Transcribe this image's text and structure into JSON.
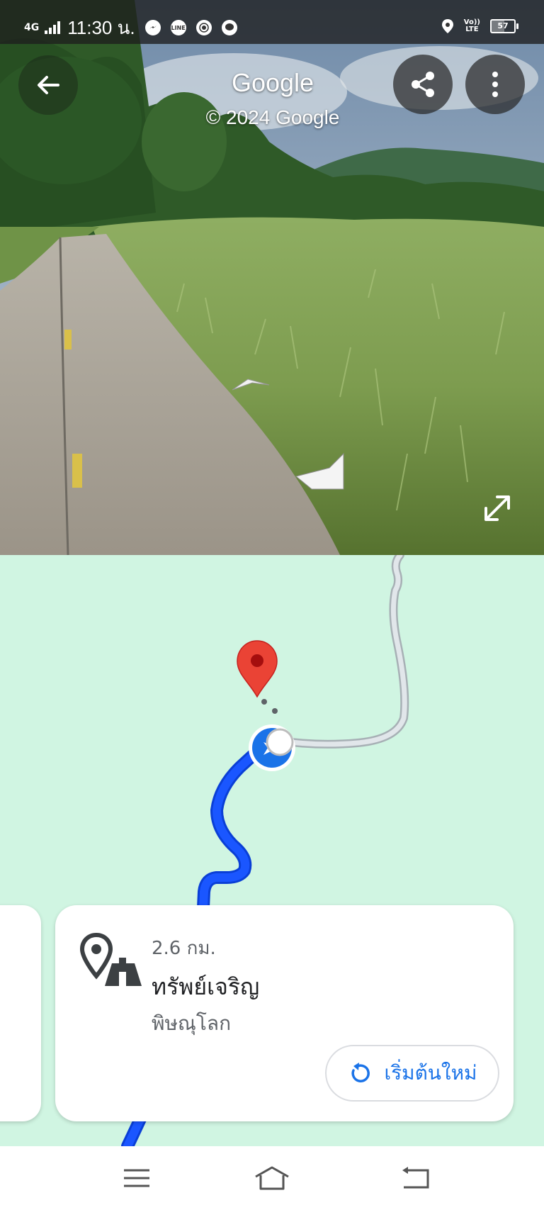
{
  "status_bar": {
    "network": "4G",
    "time": "11:30 น.",
    "line_badge": "LINE",
    "volte": [
      "Vo))",
      "LTE"
    ],
    "battery_percent": 57
  },
  "street_view": {
    "title": "Google",
    "copyright": "© 2024 Google",
    "icons": [
      "back-arrow-icon",
      "share-icon",
      "more-vert-icon",
      "expand-icon"
    ]
  },
  "card": {
    "distance": "2.6 กม.",
    "place_name": "ทรัพย์เจริญ",
    "place_area": "พิษณุโลก",
    "restart_label": "เริ่มต้นใหม่"
  },
  "colors": {
    "map_background": "#d0f5e2",
    "route_blue": "#1a56ff",
    "accent": "#1a73e8",
    "pin_red": "#ea4335"
  }
}
